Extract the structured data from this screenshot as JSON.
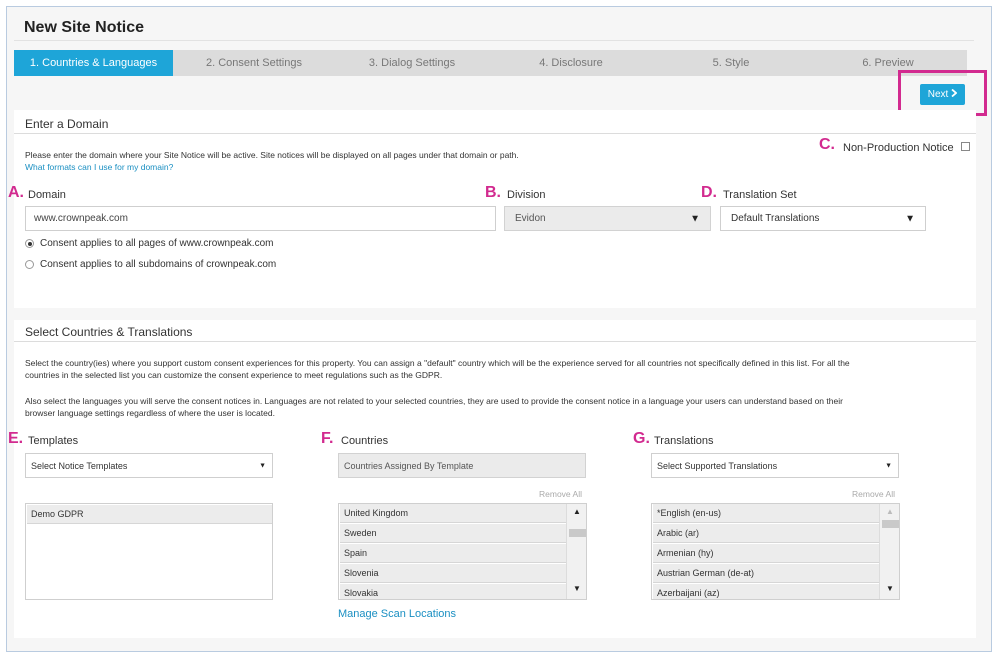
{
  "page": {
    "title": "New Site Notice"
  },
  "steps": [
    {
      "label": "1. Countries & Languages",
      "active": true
    },
    {
      "label": "2. Consent Settings",
      "active": false
    },
    {
      "label": "3. Dialog Settings",
      "active": false
    },
    {
      "label": "4. Disclosure",
      "active": false
    },
    {
      "label": "5. Style",
      "active": false
    },
    {
      "label": "6. Preview",
      "active": false
    }
  ],
  "next_button": {
    "label": "Next",
    "icon": "chevron-right-icon"
  },
  "annotations": {
    "a": "A.",
    "b": "B.",
    "c": "C.",
    "d": "D.",
    "e": "E.",
    "f": "F.",
    "g": "G."
  },
  "domain_section": {
    "title": "Enter a Domain",
    "description": "Please enter the domain where your Site Notice will be active. Site notices will be displayed on all pages under that domain or path.",
    "help_link": "What formats can I use for my domain?",
    "non_production_label": "Non-Production Notice",
    "domain_label": "Domain",
    "domain_value": "www.crownpeak.com",
    "division_label": "Division",
    "division_value": "Evidon",
    "translation_set_label": "Translation Set",
    "translation_set_value": "Default Translations",
    "radio_all_pages": "Consent applies to all pages of www.crownpeak.com",
    "radio_subdomains": "Consent applies to all subdomains of crownpeak.com"
  },
  "countries_section": {
    "title": "Select Countries & Translations",
    "paragraph1_line1": "Select the country(ies) where you support custom consent experiences for this property. You can assign a \"default\" country which will be the experience served for all countries not specifically defined in this list. For all the",
    "paragraph1_line2": "countries in the selected list you can customize the consent experience to meet regulations such as the GDPR.",
    "paragraph2_line1": "Also select the languages you will serve the consent notices in. Languages are not related to your selected countries, they are used to provide the consent notice in a language your users can understand based on their",
    "paragraph2_line2": "browser language settings regardless of where the user is located.",
    "templates_label": "Templates",
    "templates_placeholder": "Select Notice Templates",
    "templates_items": [
      "Demo GDPR"
    ],
    "countries_label": "Countries",
    "countries_placeholder": "Countries Assigned By Template",
    "countries_remove_all": "Remove All",
    "countries_items": [
      "United Kingdom",
      "Sweden",
      "Spain",
      "Slovenia",
      "Slovakia"
    ],
    "manage_link": "Manage Scan Locations",
    "translations_label": "Translations",
    "translations_placeholder": "Select Supported Translations",
    "translations_remove_all": "Remove All",
    "translations_items": [
      "*English (en-us)",
      "Arabic (ar)",
      "Armenian (hy)",
      "Austrian German (de-at)",
      "Azerbaijani (az)"
    ]
  },
  "colors": {
    "accent": "#1ea5d8",
    "annotation": "#d22a8f"
  }
}
